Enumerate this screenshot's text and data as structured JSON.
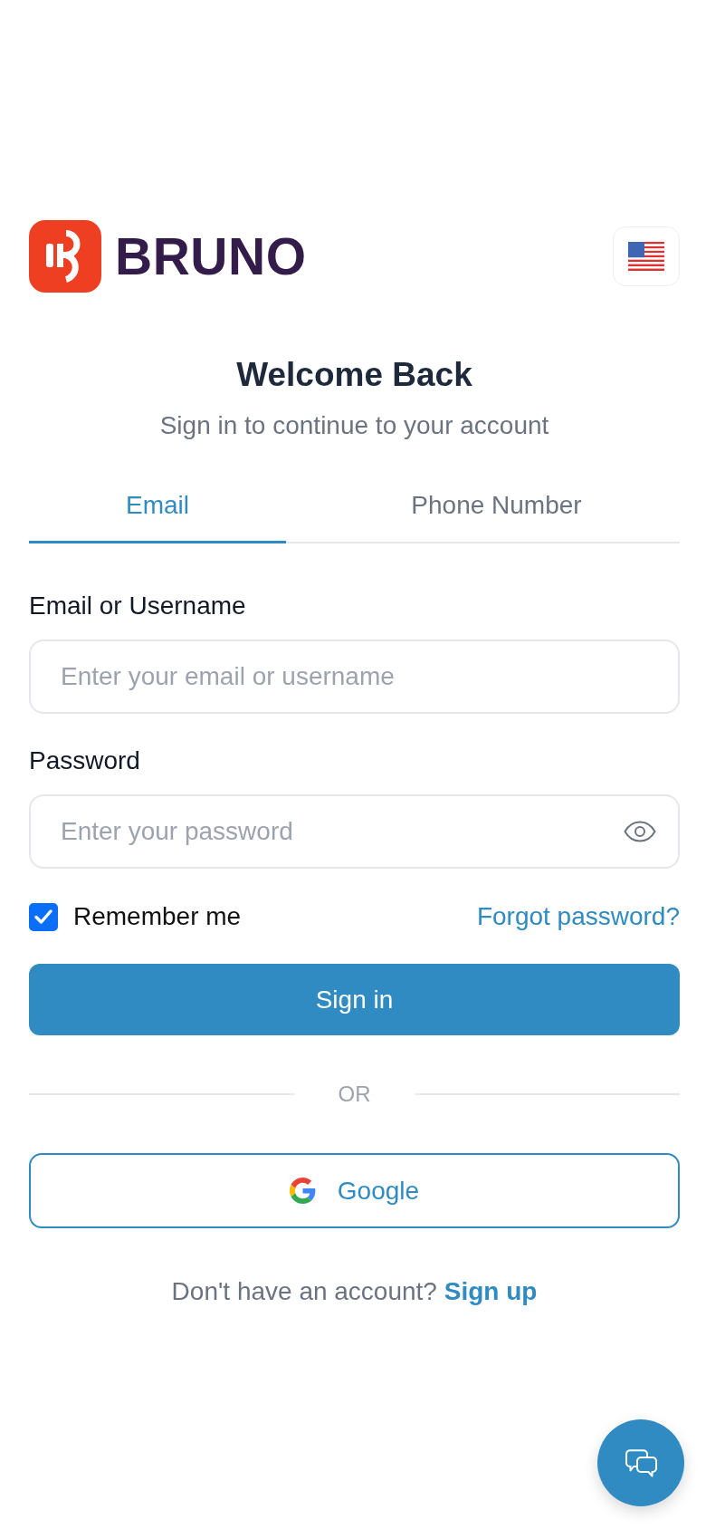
{
  "logo": {
    "text": "BRUNO"
  },
  "heading": {
    "title": "Welcome Back",
    "subtitle": "Sign in to continue to your account"
  },
  "tabs": [
    {
      "label": "Email",
      "selected": true
    },
    {
      "label": "Phone Number",
      "selected": false
    }
  ],
  "form": {
    "fields": [
      {
        "kind": "text",
        "label": "Email or Username",
        "placeholder": "Enter your email or username"
      },
      {
        "kind": "password",
        "label": "Password",
        "placeholder": "Enter your password"
      }
    ],
    "remember_me": {
      "label": "Remember me",
      "checked": true
    },
    "forgot_password": "Forgot password?",
    "submit": "Sign in"
  },
  "divider": "OR",
  "google_button": {
    "label": "Google"
  },
  "signup_prompt": {
    "text": "Don't have an account?",
    "link": "Sign up"
  }
}
